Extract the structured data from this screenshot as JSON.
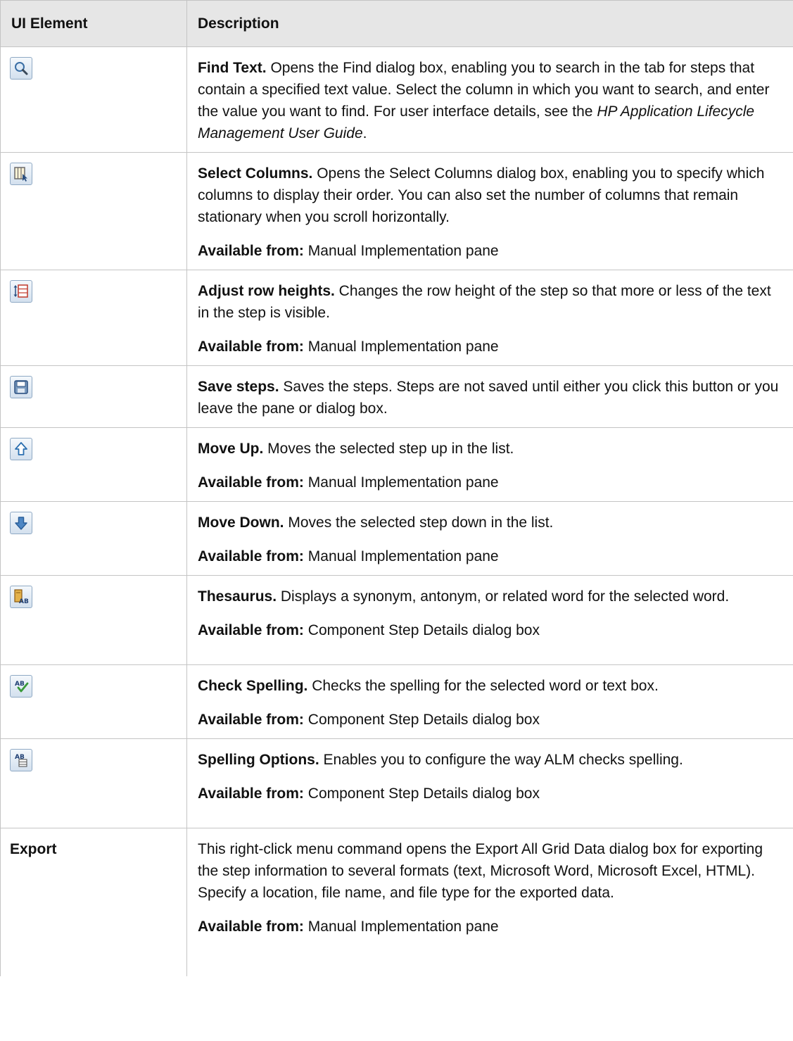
{
  "table": {
    "headers": [
      "UI Element",
      "Description"
    ],
    "rows": [
      {
        "element": {
          "icon": "magnifier-icon"
        },
        "title": "Find Text.",
        "desc_before": " Opens the Find dialog box, enabling you to search in the tab for steps that contain a specified text value. Select the column in which you want to search, and enter the value you want to find. For user interface details, see the ",
        "desc_italic": "HP Application Lifecycle Management User Guide",
        "desc_after": "."
      },
      {
        "element": {
          "icon": "select-columns-icon"
        },
        "title": "Select Columns.",
        "desc": " Opens the Select Columns dialog box, enabling you to specify which columns to display their order. You can also set the number of columns that remain stationary when you scroll horizontally.",
        "available_label": "Available from:",
        "available_value": " Manual Implementation pane"
      },
      {
        "element": {
          "icon": "adjust-row-heights-icon"
        },
        "title": "Adjust row heights.",
        "desc": " Changes the row height of the step so that more or less of the text in the step is visible.",
        "available_label": "Available from:",
        "available_value": " Manual Implementation pane"
      },
      {
        "element": {
          "icon": "save-icon"
        },
        "title": "Save steps.",
        "desc": " Saves the steps. Steps are not saved until either you click this button or you leave the pane or dialog box."
      },
      {
        "element": {
          "icon": "move-up-icon"
        },
        "title": "Move Up.",
        "desc": " Moves the selected step up in the list.",
        "available_label": "Available from:",
        "available_value": " Manual Implementation pane"
      },
      {
        "element": {
          "icon": "move-down-icon"
        },
        "title": "Move Down.",
        "desc": " Moves the selected step down in the list.",
        "available_label": "Available from:",
        "available_value": " Manual Implementation pane"
      },
      {
        "element": {
          "icon": "thesaurus-icon"
        },
        "title": "Thesaurus.",
        "desc": " Displays a synonym, antonym, or related word for the selected word.",
        "available_label": "Available from:",
        "available_value": " Component Step Details dialog box"
      },
      {
        "element": {
          "icon": "check-spelling-icon"
        },
        "title": "Check Spelling.",
        "desc": " Checks the spelling for the selected word or text box.",
        "available_label": "Available from:",
        "available_value": " Component Step Details dialog box"
      },
      {
        "element": {
          "icon": "spelling-options-icon"
        },
        "title": "Spelling Options.",
        "desc": " Enables you to configure the way ALM checks spelling.",
        "available_label": "Available from:",
        "available_value": " Component Step Details dialog box"
      },
      {
        "element": {
          "label": "Export"
        },
        "desc": "This right-click menu command opens the Export All Grid Data dialog box for exporting the step information to several formats (text, Microsoft Word, Microsoft Excel, HTML). Specify a location, file name, and file type for the exported data.",
        "available_label": "Available from:",
        "available_value": " Manual Implementation pane"
      }
    ]
  }
}
